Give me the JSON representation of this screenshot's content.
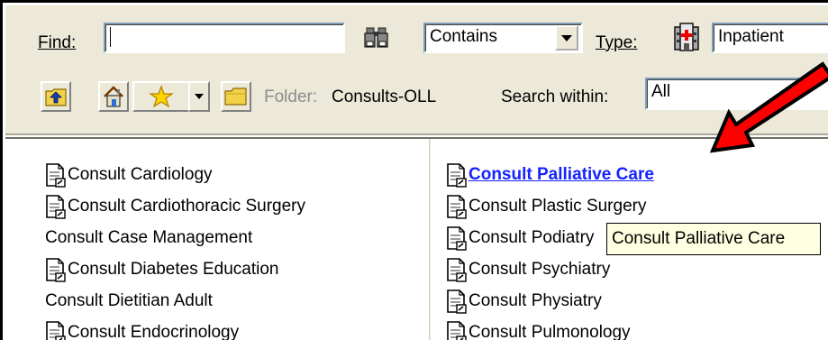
{
  "toolbar": {
    "find_label": "Find:",
    "find_value": "",
    "match_mode": "Contains",
    "type_label": "Type:",
    "type_value": "Inpatient",
    "folder_label": "Folder:",
    "folder_value": "Consults-OLL",
    "search_within_label": "Search within:",
    "search_within_value": "All"
  },
  "list": {
    "left_column": [
      {
        "label": "Consult Cardiology",
        "icon": "order-document-icon"
      },
      {
        "label": "Consult Cardiothoracic Surgery",
        "icon": "order-document-icon"
      },
      {
        "label": "Consult Case Management",
        "icon": ""
      },
      {
        "label": "Consult Diabetes Education",
        "icon": "order-document-icon"
      },
      {
        "label": "Consult Dietitian Adult",
        "icon": ""
      },
      {
        "label": "Consult Endocrinology",
        "icon": "order-document-icon"
      }
    ],
    "right_column": [
      {
        "label": "Consult Palliative Care",
        "icon": "order-document-icon",
        "highlighted": true
      },
      {
        "label": "Consult Plastic Surgery",
        "icon": "order-document-icon"
      },
      {
        "label": "Consult Podiatry",
        "icon": "order-document-icon"
      },
      {
        "label": "Consult Psychiatry",
        "icon": "order-document-icon"
      },
      {
        "label": "Consult Physiatry",
        "icon": "order-document-icon"
      },
      {
        "label": "Consult Pulmonology",
        "icon": "order-document-icon"
      }
    ]
  },
  "tooltip": "Consult Palliative Care",
  "colors": {
    "window_bg": "#ece9d8",
    "link": "#1523ff",
    "tooltip_bg": "#ffffe1",
    "annotation_arrow": "#ff0000"
  }
}
